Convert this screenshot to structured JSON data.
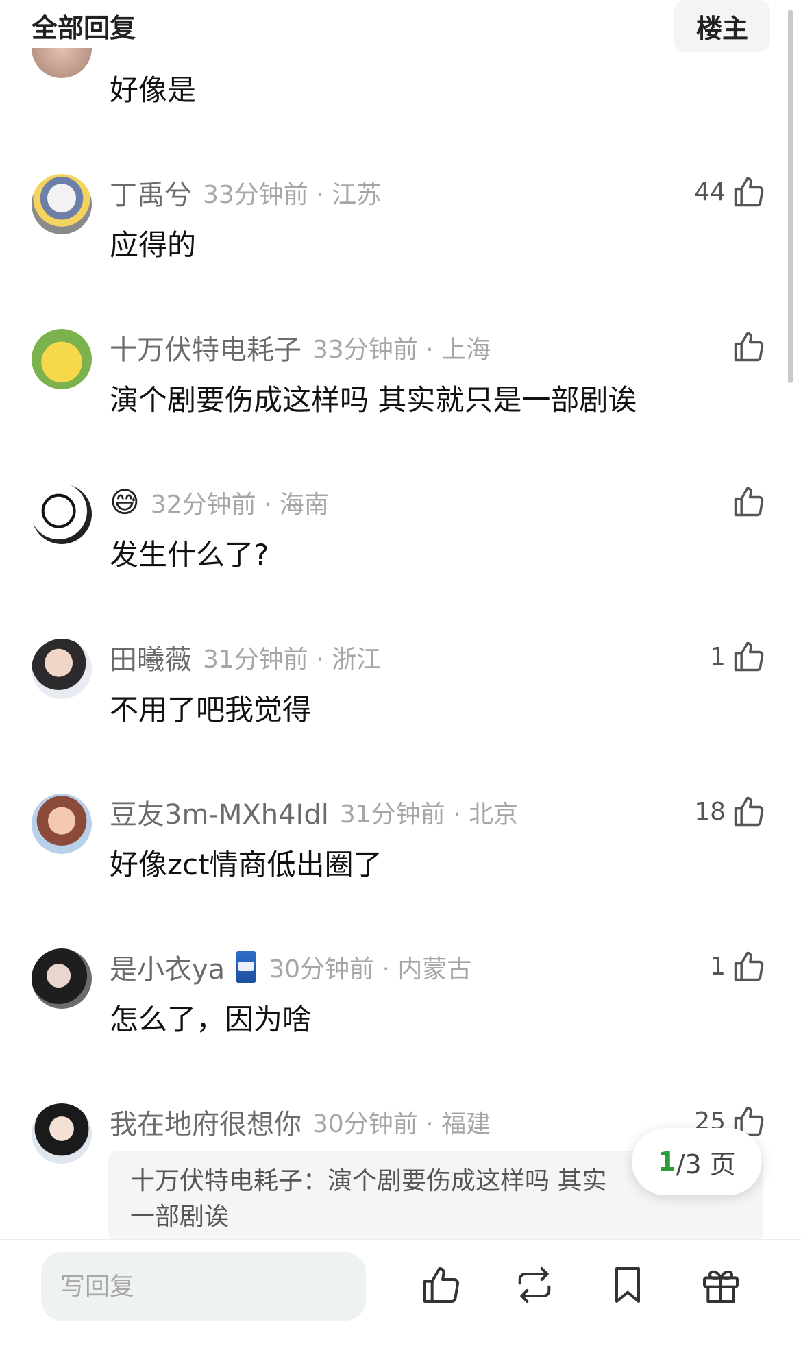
{
  "header": {
    "title": "全部回复",
    "op_label": "楼主"
  },
  "first_comment_text": "好像是",
  "comments": [
    {
      "username": "丁禹兮",
      "time": "33分钟前",
      "location": "江苏",
      "meta": "33分钟前 · 江苏",
      "text": "应得的",
      "likes": "44",
      "avatar_icon": "avatar-cartoon"
    },
    {
      "username": "十万伏特电耗子",
      "time": "33分钟前",
      "location": "上海",
      "meta": "33分钟前 · 上海",
      "text": "演个剧要伤成这样吗 其实就只是一部剧诶",
      "likes": "",
      "avatar_icon": "avatar-pikachu"
    },
    {
      "username": "😅",
      "time": "32分钟前",
      "location": "海南",
      "meta": "32分钟前 · 海南",
      "text": "发生什么了?",
      "likes": "",
      "avatar_icon": "avatar-meme"
    },
    {
      "username": "田曦薇",
      "time": "31分钟前",
      "location": "浙江",
      "meta": "31分钟前 · 浙江",
      "text": "不用了吧我觉得",
      "likes": "1",
      "avatar_icon": "avatar-photo"
    },
    {
      "username": "豆友3m-MXh4Idl",
      "time": "31分钟前",
      "location": "北京",
      "meta": "31分钟前 · 北京",
      "text": "好像zct情商低出圈了",
      "likes": "18",
      "avatar_icon": "avatar-girl"
    },
    {
      "username": "是小衣ya",
      "time": "30分钟前",
      "location": "内蒙古",
      "meta": "30分钟前 · 内蒙古",
      "text": "怎么了，因为啥",
      "likes": "1",
      "avatar_icon": "avatar-photo"
    },
    {
      "username": "我在地府很想你",
      "time": "30分钟前",
      "location": "福建",
      "meta": "30分钟前 · 福建",
      "text": "",
      "likes": "25",
      "avatar_icon": "avatar-photo"
    }
  ],
  "quote": {
    "line1": "十万伏特电耗子：演个剧要伤成这样吗 其实",
    "line2": "一部剧诶"
  },
  "pagination": {
    "current": "1",
    "rest": "/3 页"
  },
  "bottom_bar": {
    "reply_placeholder": "写回复"
  },
  "colors": {
    "accent": "#2e9b3c",
    "meta_gray": "#a6a6a6",
    "name_gray": "#6b6b6b"
  }
}
